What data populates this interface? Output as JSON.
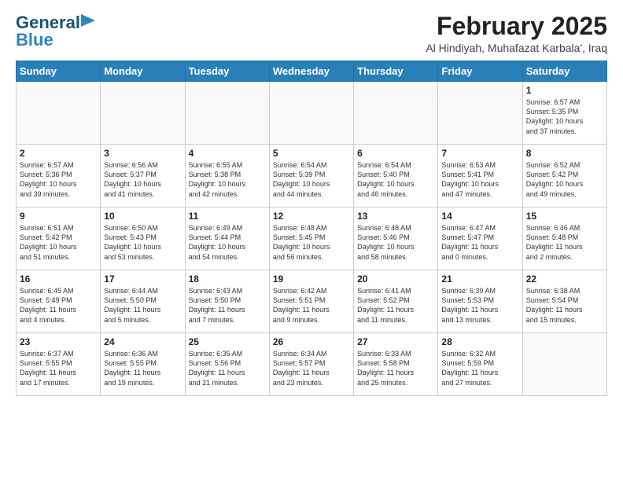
{
  "header": {
    "logo_line1": "General",
    "logo_line2": "Blue",
    "title": "February 2025",
    "subtitle": "Al Hindiyah, Muhafazat Karbala', Iraq"
  },
  "weekdays": [
    "Sunday",
    "Monday",
    "Tuesday",
    "Wednesday",
    "Thursday",
    "Friday",
    "Saturday"
  ],
  "weeks": [
    [
      {
        "num": "",
        "info": ""
      },
      {
        "num": "",
        "info": ""
      },
      {
        "num": "",
        "info": ""
      },
      {
        "num": "",
        "info": ""
      },
      {
        "num": "",
        "info": ""
      },
      {
        "num": "",
        "info": ""
      },
      {
        "num": "1",
        "info": "Sunrise: 6:57 AM\nSunset: 5:35 PM\nDaylight: 10 hours\nand 37 minutes."
      }
    ],
    [
      {
        "num": "2",
        "info": "Sunrise: 6:57 AM\nSunset: 5:36 PM\nDaylight: 10 hours\nand 39 minutes."
      },
      {
        "num": "3",
        "info": "Sunrise: 6:56 AM\nSunset: 5:37 PM\nDaylight: 10 hours\nand 41 minutes."
      },
      {
        "num": "4",
        "info": "Sunrise: 6:55 AM\nSunset: 5:38 PM\nDaylight: 10 hours\nand 42 minutes."
      },
      {
        "num": "5",
        "info": "Sunrise: 6:54 AM\nSunset: 5:39 PM\nDaylight: 10 hours\nand 44 minutes."
      },
      {
        "num": "6",
        "info": "Sunrise: 6:54 AM\nSunset: 5:40 PM\nDaylight: 10 hours\nand 46 minutes."
      },
      {
        "num": "7",
        "info": "Sunrise: 6:53 AM\nSunset: 5:41 PM\nDaylight: 10 hours\nand 47 minutes."
      },
      {
        "num": "8",
        "info": "Sunrise: 6:52 AM\nSunset: 5:42 PM\nDaylight: 10 hours\nand 49 minutes."
      }
    ],
    [
      {
        "num": "9",
        "info": "Sunrise: 6:51 AM\nSunset: 5:42 PM\nDaylight: 10 hours\nand 51 minutes."
      },
      {
        "num": "10",
        "info": "Sunrise: 6:50 AM\nSunset: 5:43 PM\nDaylight: 10 hours\nand 53 minutes."
      },
      {
        "num": "11",
        "info": "Sunrise: 6:49 AM\nSunset: 5:44 PM\nDaylight: 10 hours\nand 54 minutes."
      },
      {
        "num": "12",
        "info": "Sunrise: 6:48 AM\nSunset: 5:45 PM\nDaylight: 10 hours\nand 56 minutes."
      },
      {
        "num": "13",
        "info": "Sunrise: 6:48 AM\nSunset: 5:46 PM\nDaylight: 10 hours\nand 58 minutes."
      },
      {
        "num": "14",
        "info": "Sunrise: 6:47 AM\nSunset: 5:47 PM\nDaylight: 11 hours\nand 0 minutes."
      },
      {
        "num": "15",
        "info": "Sunrise: 6:46 AM\nSunset: 5:48 PM\nDaylight: 11 hours\nand 2 minutes."
      }
    ],
    [
      {
        "num": "16",
        "info": "Sunrise: 6:45 AM\nSunset: 5:49 PM\nDaylight: 11 hours\nand 4 minutes."
      },
      {
        "num": "17",
        "info": "Sunrise: 6:44 AM\nSunset: 5:50 PM\nDaylight: 11 hours\nand 5 minutes."
      },
      {
        "num": "18",
        "info": "Sunrise: 6:43 AM\nSunset: 5:50 PM\nDaylight: 11 hours\nand 7 minutes."
      },
      {
        "num": "19",
        "info": "Sunrise: 6:42 AM\nSunset: 5:51 PM\nDaylight: 11 hours\nand 9 minutes."
      },
      {
        "num": "20",
        "info": "Sunrise: 6:41 AM\nSunset: 5:52 PM\nDaylight: 11 hours\nand 11 minutes."
      },
      {
        "num": "21",
        "info": "Sunrise: 6:39 AM\nSunset: 5:53 PM\nDaylight: 11 hours\nand 13 minutes."
      },
      {
        "num": "22",
        "info": "Sunrise: 6:38 AM\nSunset: 5:54 PM\nDaylight: 11 hours\nand 15 minutes."
      }
    ],
    [
      {
        "num": "23",
        "info": "Sunrise: 6:37 AM\nSunset: 5:55 PM\nDaylight: 11 hours\nand 17 minutes."
      },
      {
        "num": "24",
        "info": "Sunrise: 6:36 AM\nSunset: 5:55 PM\nDaylight: 11 hours\nand 19 minutes."
      },
      {
        "num": "25",
        "info": "Sunrise: 6:35 AM\nSunset: 5:56 PM\nDaylight: 11 hours\nand 21 minutes."
      },
      {
        "num": "26",
        "info": "Sunrise: 6:34 AM\nSunset: 5:57 PM\nDaylight: 11 hours\nand 23 minutes."
      },
      {
        "num": "27",
        "info": "Sunrise: 6:33 AM\nSunset: 5:58 PM\nDaylight: 11 hours\nand 25 minutes."
      },
      {
        "num": "28",
        "info": "Sunrise: 6:32 AM\nSunset: 5:59 PM\nDaylight: 11 hours\nand 27 minutes."
      },
      {
        "num": "",
        "info": ""
      }
    ]
  ]
}
